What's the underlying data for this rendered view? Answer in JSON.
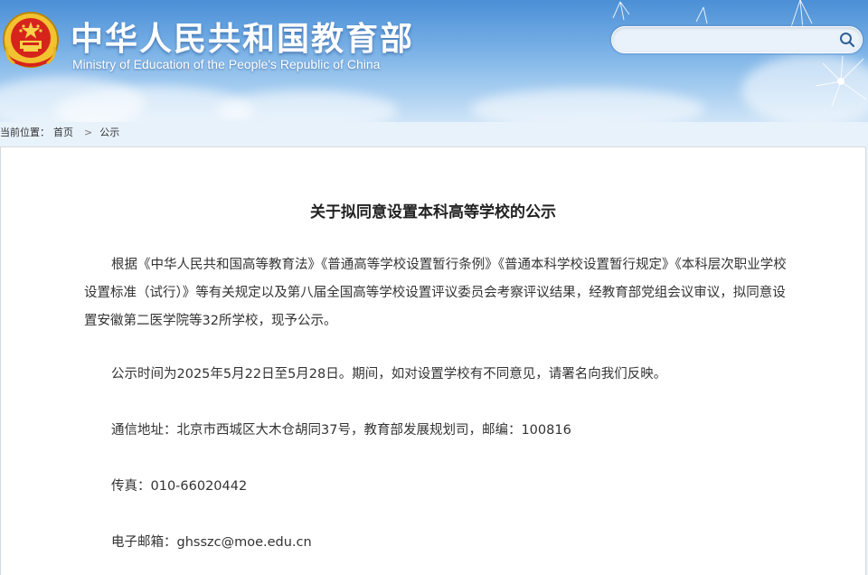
{
  "header": {
    "site_title": "中华人民共和国教育部",
    "site_subtitle": "Ministry of Education of the People's Republic of China",
    "search": {
      "placeholder": ""
    }
  },
  "breadcrumb": {
    "prefix": "当前位置：",
    "home": "首页",
    "separator": ">",
    "current": "公示"
  },
  "article": {
    "title": "关于拟同意设置本科高等学校的公示",
    "paragraphs": [
      "根据《中华人民共和国高等教育法》《普通高等学校设置暂行条例》《普通本科学校设置暂行规定》《本科层次职业学校设置标准（试行）》等有关规定以及第八届全国高等学校设置评议委员会考察评议结果，经教育部党组会议审议，拟同意设置安徽第二医学院等32所学校，现予公示。",
      "公示时间为2025年5月22日至5月28日。期间，如对设置学校有不同意见，请署名向我们反映。",
      "通信地址：北京市西城区大木仓胡同37号，教育部发展规划司，邮编：100816",
      "传真：010-66020442",
      "电子邮箱：ghsszc@moe.edu.cn"
    ]
  }
}
